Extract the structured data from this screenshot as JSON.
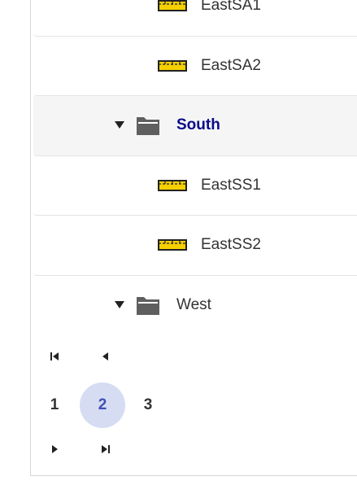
{
  "tree": {
    "items": [
      {
        "label": "EastSA1",
        "type": "item",
        "icon": "ruler-icon"
      },
      {
        "label": "EastSA2",
        "type": "item",
        "icon": "ruler-icon"
      },
      {
        "label": "South",
        "type": "folder",
        "icon": "folder-open-icon",
        "expanded": true,
        "selected": true
      },
      {
        "label": "EastSS1",
        "type": "item",
        "icon": "ruler-icon"
      },
      {
        "label": "EastSS2",
        "type": "item",
        "icon": "ruler-icon"
      },
      {
        "label": "West",
        "type": "folder",
        "icon": "folder-open-icon",
        "expanded": true,
        "selected": false
      }
    ]
  },
  "pager": {
    "pages": [
      "1",
      "2",
      "3"
    ],
    "current_page": "2",
    "controls": [
      "first-page-icon",
      "previous-page-icon",
      "next-page-icon",
      "last-page-icon"
    ]
  },
  "colors": {
    "selected_row_bg": "#f5f5f5",
    "selected_label": "#0a0a8a",
    "active_page_bg": "#d6dcf2",
    "active_page_text": "#3f51b5",
    "ruler_fill": "#f5d000",
    "folder_fill": "#5f5f5f"
  }
}
